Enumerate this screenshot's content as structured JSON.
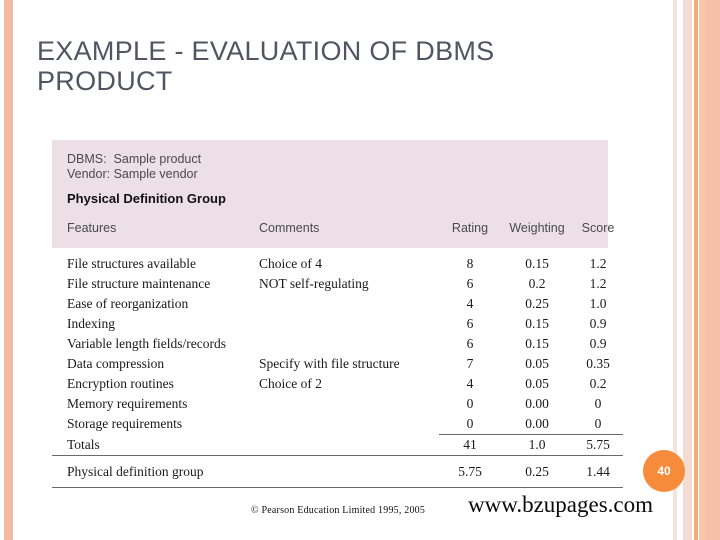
{
  "slide": {
    "title": "EXAMPLE - EVALUATION OF DBMS\nPRODUCT",
    "page_number": "40",
    "copyright": "© Pearson Education Limited 1995, 2005",
    "watermark": "www.bzupages.com",
    "accent_color": "#f68b3c",
    "title_color": "#4f5661",
    "panel_color": "#eddfe6"
  },
  "table": {
    "meta": {
      "dbms_line": "DBMS:  Sample product",
      "vendor_line": "Vendor: Sample vendor",
      "group_title": "Physical Definition Group"
    },
    "columns": [
      "Features",
      "Comments",
      "Rating",
      "Weighting",
      "Score"
    ],
    "rows": [
      {
        "feature": "File structures available",
        "comment": "Choice of 4",
        "rating": "8",
        "weighting": "0.15",
        "score": "1.2"
      },
      {
        "feature": "File structure maintenance",
        "comment": "NOT self-regulating",
        "rating": "6",
        "weighting": "0.2",
        "score": "1.2"
      },
      {
        "feature": "Ease of reorganization",
        "comment": "",
        "rating": "4",
        "weighting": "0.25",
        "score": "1.0"
      },
      {
        "feature": "Indexing",
        "comment": "",
        "rating": "6",
        "weighting": "0.15",
        "score": "0.9"
      },
      {
        "feature": "Variable length fields/records",
        "comment": "",
        "rating": "6",
        "weighting": "0.15",
        "score": "0.9"
      },
      {
        "feature": "Data compression",
        "comment": "Specify with file structure",
        "rating": "7",
        "weighting": "0.05",
        "score": "0.35"
      },
      {
        "feature": "Encryption routines",
        "comment": "Choice of 2",
        "rating": "4",
        "weighting": "0.05",
        "score": "0.2"
      },
      {
        "feature": "Memory requirements",
        "comment": "",
        "rating": "0",
        "weighting": "0.00",
        "score": "0"
      },
      {
        "feature": "Storage requirements",
        "comment": "",
        "rating": "0",
        "weighting": "0.00",
        "score": "0"
      }
    ],
    "totals": {
      "feature": "Totals",
      "comment": "",
      "rating": "41",
      "weighting": "1.0",
      "score": "5.75"
    },
    "summary": {
      "feature": "Physical definition group",
      "comment": "",
      "rating": "5.75",
      "weighting": "0.25",
      "score": "1.44"
    }
  }
}
